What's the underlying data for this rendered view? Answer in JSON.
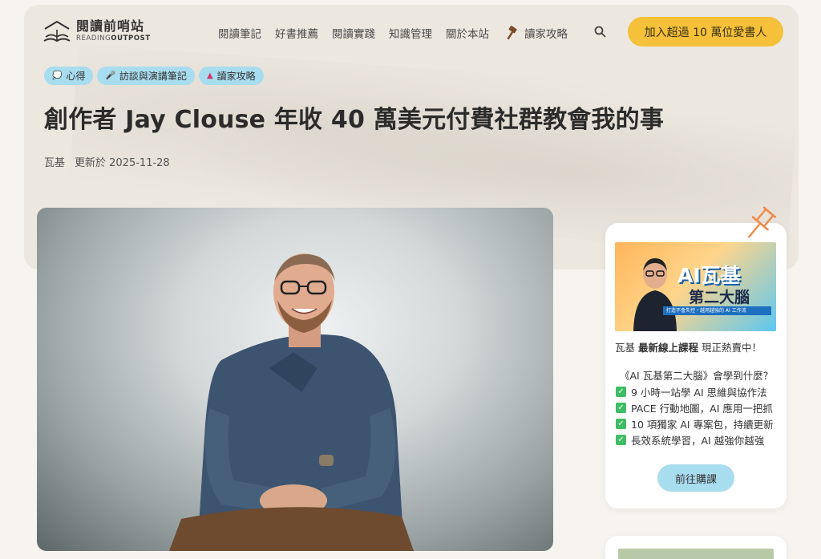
{
  "header": {
    "logo_zh": "閱讀前哨站",
    "logo_en_1": "READING",
    "logo_en_2": "OUTPOST",
    "nav": [
      "閱讀筆記",
      "好書推薦",
      "閱讀實踐",
      "知識管理",
      "關於本站"
    ],
    "nav_special": "讀家攻略",
    "cta": "加入超過 10 萬位愛書人"
  },
  "tags": [
    {
      "icon": "💭",
      "label": "心得"
    },
    {
      "icon": "🎤",
      "label": "訪談與演講筆記"
    },
    {
      "icon": "▲",
      "label": "讀家攻略"
    }
  ],
  "article": {
    "title": "創作者 Jay Clouse 年收 40 萬美元付費社群教會我的事",
    "author": "瓦基",
    "updated": "更新於 2025-11-28"
  },
  "sidebar": {
    "banner_title": "AI瓦基",
    "banner_sub": "第二大腦",
    "banner_strip": "打造不會失控・越用越強的 AI 工作流",
    "line1_a": "瓦基 ",
    "line1_b": "最新線上課程",
    "line1_c": " 現正熱賣中！",
    "question": "《AI 瓦基第二大腦》會學到什麼？",
    "items": [
      "9 小時一站學 AI 思維與協作法",
      "PACE 行動地圖，AI 應用一把抓",
      "10 項獨家 AI 專案包，持續更新",
      "長效系統學習，AI 越強你越強"
    ],
    "buy": "前往購課"
  },
  "colors": {
    "cta": "#f5c03a",
    "tag": "#a8dcef",
    "check": "#3ebd64"
  }
}
